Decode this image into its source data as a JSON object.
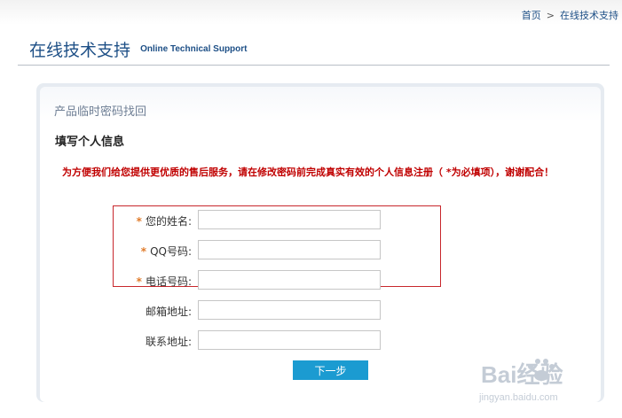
{
  "breadcrumb": {
    "home": "首页",
    "separator": ">",
    "current": "在线技术支持"
  },
  "header": {
    "title": "在线技术支持",
    "subtitle": "Online Technical Support"
  },
  "section": {
    "title": "产品临时密码找回"
  },
  "form": {
    "title": "填写个人信息",
    "notice": "为方便我们给您提供更优质的售后服务，请在修改密码前完成真实有效的个人信息注册（ *为必填项），谢谢配合！",
    "required_mark": "*",
    "fields": [
      {
        "label": "您的姓名:",
        "required": true,
        "value": ""
      },
      {
        "label": "QQ号码:",
        "required": true,
        "value": ""
      },
      {
        "label": "电话号码:",
        "required": true,
        "value": ""
      },
      {
        "label": "邮箱地址:",
        "required": false,
        "value": ""
      },
      {
        "label": "联系地址:",
        "required": false,
        "value": ""
      }
    ],
    "next_label": "下一步"
  },
  "watermark": {
    "text": "Bai经验",
    "url_text": "jingyan.baidu.com"
  },
  "colors": {
    "brand_blue": "#1d4f86",
    "button_blue": "#1b9bd1",
    "notice_red": "#c00000",
    "required_star": "#e07b2a",
    "highlight_red": "#c8272c"
  }
}
